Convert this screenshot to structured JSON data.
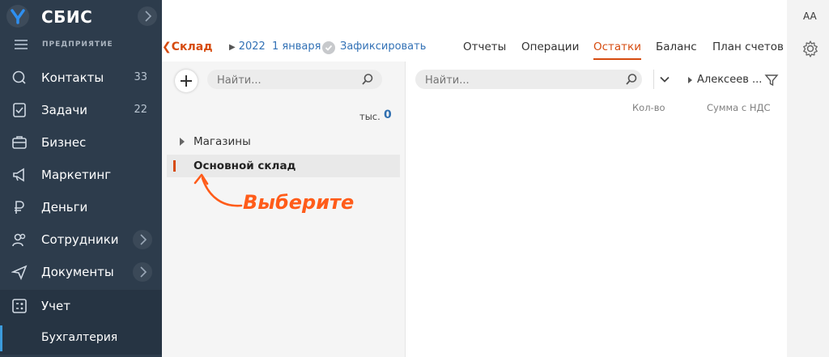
{
  "app": {
    "title": "СБИС",
    "organization": "ПРЕДПРИЯТИЕ"
  },
  "sidebar": {
    "items": [
      {
        "label": "Контакты",
        "count": "33",
        "icon": "chat-icon"
      },
      {
        "label": "Задачи",
        "count": "22",
        "icon": "task-icon"
      },
      {
        "label": "Бизнес",
        "icon": "briefcase-icon"
      },
      {
        "label": "Маркетинг",
        "icon": "megaphone-icon"
      },
      {
        "label": "Деньги",
        "icon": "ruble-icon"
      },
      {
        "label": "Сотрудники",
        "icon": "people-icon"
      },
      {
        "label": "Документы",
        "icon": "paper-plane-icon"
      },
      {
        "label": "Учет",
        "icon": "calculator-icon"
      }
    ],
    "sub_item": "Бухгалтерия"
  },
  "toolbar": {
    "warehouse": "Склад",
    "year": "2022",
    "date": "1 января",
    "fix": "Зафиксировать"
  },
  "tabs": [
    "Отчеты",
    "Операции",
    "Остатки",
    "Баланс",
    "План счетов"
  ],
  "active_tab": "Остатки",
  "left_pane": {
    "search_placeholder": "Найти...",
    "unit": "тыс.",
    "unit_value": "0",
    "tree": [
      "Магазины",
      "Основной склад"
    ]
  },
  "right_pane": {
    "search_placeholder": "Найти...",
    "person": "Алексеев ...",
    "columns": [
      "Кол-во",
      "Сумма с НДС"
    ]
  },
  "callout": "Выберите",
  "rail": {
    "font_label": "AA"
  },
  "colors": {
    "accent": "#d64b0f",
    "link": "#3372b6",
    "sidebar": "#2d3c4c",
    "callout": "#ff5c1a"
  }
}
